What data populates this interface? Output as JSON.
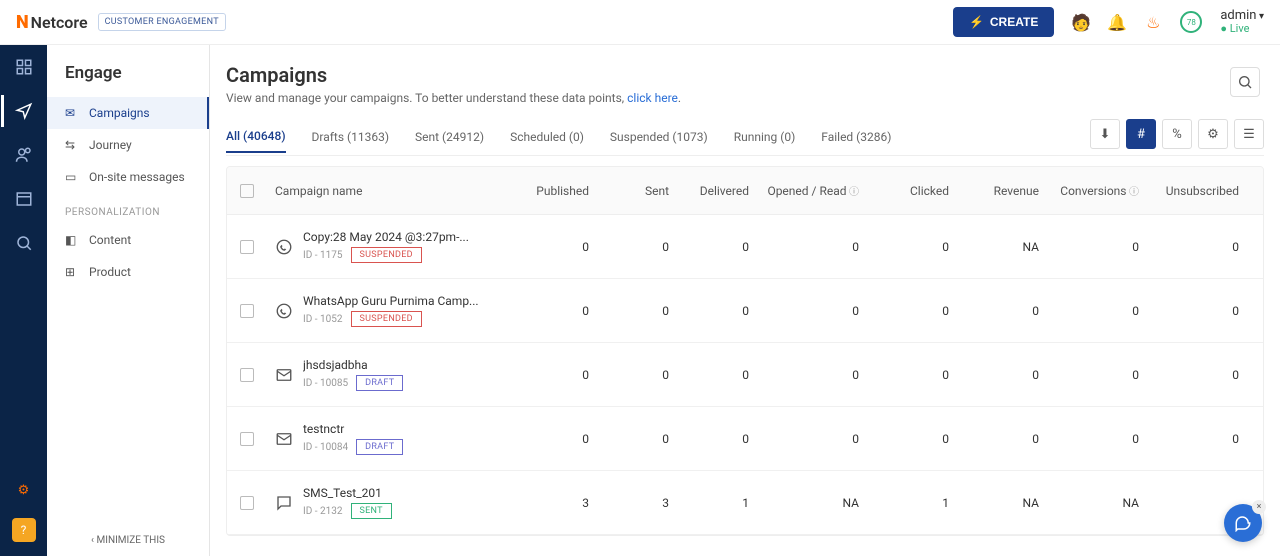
{
  "header": {
    "brand": "Netcore",
    "ce_badge": "CUSTOMER ENGAGEMENT",
    "create_label": "CREATE",
    "admin_label": "admin",
    "live_label": "Live",
    "ring_value": "78"
  },
  "sidebar": {
    "title": "Engage",
    "items": [
      "Campaigns",
      "Journey",
      "On-site messages"
    ],
    "section_label": "PERSONALIZATION",
    "pers_items": [
      "Content",
      "Product"
    ],
    "minimize_label": "MINIMIZE THIS"
  },
  "page": {
    "title": "Campaigns",
    "subtitle_pre": "View and manage your campaigns. To better understand these data points, ",
    "subtitle_link": "click here"
  },
  "tabs": [
    "All (40648)",
    "Drafts (11363)",
    "Sent (24912)",
    "Scheduled (0)",
    "Suspended (1073)",
    "Running (0)",
    "Failed (3286)"
  ],
  "toolbar": {
    "hash": "#",
    "pct": "%"
  },
  "columns": [
    "Campaign name",
    "Published",
    "Sent",
    "Delivered",
    "Opened / Read",
    "Clicked",
    "Revenue",
    "Conversions",
    "Unsubscribed"
  ],
  "rows": [
    {
      "channel": "whatsapp",
      "name": "Copy:28 May 2024 @3:27pm-...",
      "id": "ID - 1175",
      "status": "SUSPENDED",
      "status_class": "st-suspended",
      "published": "0",
      "sent": "0",
      "delivered": "0",
      "opened": "0",
      "clicked": "0",
      "revenue": "NA",
      "conversions": "0",
      "unsub": "0"
    },
    {
      "channel": "whatsapp",
      "name": "WhatsApp Guru Purnima Camp...",
      "id": "ID - 1052",
      "status": "SUSPENDED",
      "status_class": "st-suspended",
      "published": "0",
      "sent": "0",
      "delivered": "0",
      "opened": "0",
      "clicked": "0",
      "revenue": "0",
      "conversions": "0",
      "unsub": "0"
    },
    {
      "channel": "email",
      "name": "jhsdsjadbha",
      "id": "ID - 10085",
      "status": "DRAFT",
      "status_class": "st-draft",
      "published": "0",
      "sent": "0",
      "delivered": "0",
      "opened": "0",
      "clicked": "0",
      "revenue": "0",
      "conversions": "0",
      "unsub": "0"
    },
    {
      "channel": "email",
      "name": "testnctr",
      "id": "ID - 10084",
      "status": "DRAFT",
      "status_class": "st-draft",
      "published": "0",
      "sent": "0",
      "delivered": "0",
      "opened": "0",
      "clicked": "0",
      "revenue": "0",
      "conversions": "0",
      "unsub": "0"
    },
    {
      "channel": "sms",
      "name": "SMS_Test_201",
      "id": "ID - 2132",
      "status": "SENT",
      "status_class": "st-sent",
      "published": "3",
      "sent": "3",
      "delivered": "1",
      "opened": "NA",
      "clicked": "1",
      "revenue": "NA",
      "conversions": "NA",
      "unsub": ""
    }
  ]
}
